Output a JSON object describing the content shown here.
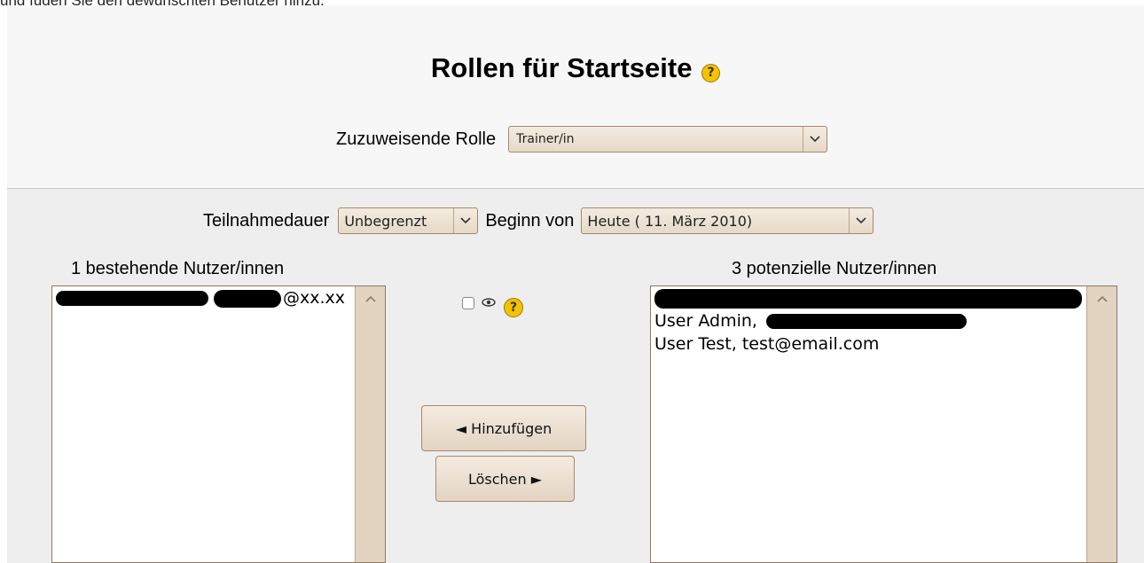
{
  "intro_text": "und fügen Sie den gewünschten Benutzer hinzu.",
  "page_title": "Rollen für Startseite",
  "role_assign": {
    "label": "Zuzuweisende Rolle",
    "selected": "Trainer/in"
  },
  "duration": {
    "label": "Teilnahmedauer",
    "selected": "Unbegrenzt"
  },
  "begin": {
    "label": "Beginn von",
    "selected": "Heute ( 11. März 2010)"
  },
  "existing_users": {
    "heading": "1 bestehende Nutzer/innen",
    "items": [
      {
        "visible_text": "@xx.xx"
      }
    ]
  },
  "potential_users": {
    "heading": "3 potenzielle Nutzer/innen",
    "items": [
      {
        "visible_text": ""
      },
      {
        "visible_text": "User Admin,"
      },
      {
        "visible_text": "User Test, test@email.com"
      }
    ]
  },
  "buttons": {
    "add": "◄ Hinzufügen",
    "remove": "Löschen ►"
  },
  "icons": {
    "help": "?",
    "eye": "👁",
    "dropdown": "⌄",
    "scroll_up": "^"
  }
}
